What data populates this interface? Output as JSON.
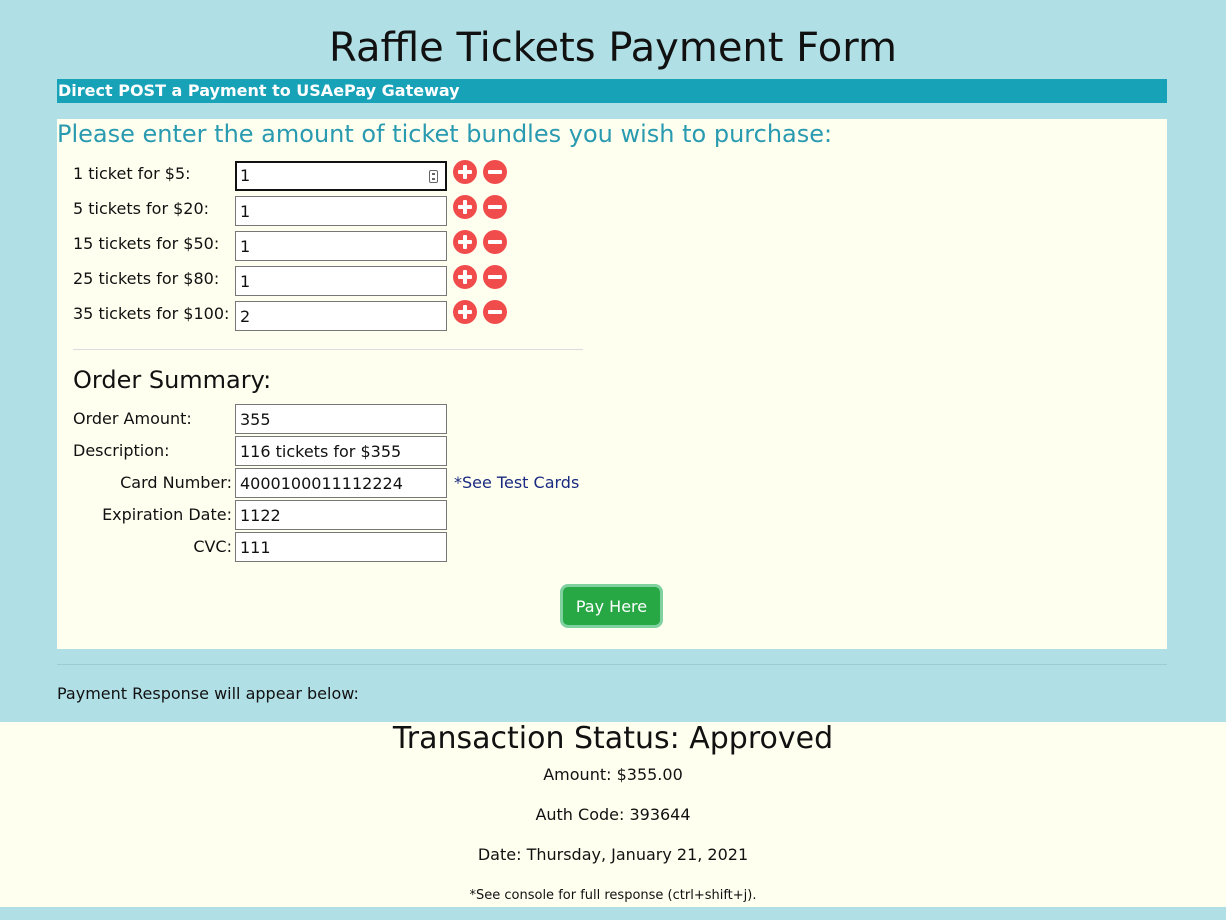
{
  "page": {
    "title": "Raffle Tickets Payment Form",
    "banner": "Direct POST a Payment to USAePay Gateway"
  },
  "tickets": {
    "heading": "Please enter the amount of ticket bundles you wish to purchase:",
    "rows": [
      {
        "label": "1 ticket for $5:",
        "value": "1"
      },
      {
        "label": "5 tickets for $20:",
        "value": "1"
      },
      {
        "label": "15 tickets for $50:",
        "value": "1"
      },
      {
        "label": "25 tickets for $80:",
        "value": "1"
      },
      {
        "label": "35 tickets for $100:",
        "value": "2"
      }
    ]
  },
  "summary": {
    "heading": "Order Summary:",
    "order_amount_label": "Order Amount:",
    "order_amount": "355",
    "description_label": "Description:",
    "description": "116 tickets for $355",
    "card_number_label": "Card Number:",
    "card_number": "4000100011112224",
    "test_cards_link": "*See Test Cards",
    "expiration_label": "Expiration Date:",
    "expiration": "1122",
    "cvc_label": "CVC:",
    "cvc": "111",
    "pay_button": "Pay Here"
  },
  "response": {
    "label": "Payment Response will appear below:",
    "status": "Transaction Status: Approved",
    "amount": "Amount: $355.00",
    "auth_code": "Auth Code: 393644",
    "date": "Date: Thursday, January 21, 2021",
    "note": "*See console for full response (ctrl+shift+j)."
  },
  "colors": {
    "background": "#b0dfe5",
    "banner": "#17a2b8",
    "panel": "#fffff0",
    "accent_text": "#2a9ab0",
    "icon_red": "#f14c4c",
    "pay_button": "#28a745"
  },
  "icons": {
    "plus": "plus-circle-icon",
    "minus": "minus-circle-icon"
  }
}
